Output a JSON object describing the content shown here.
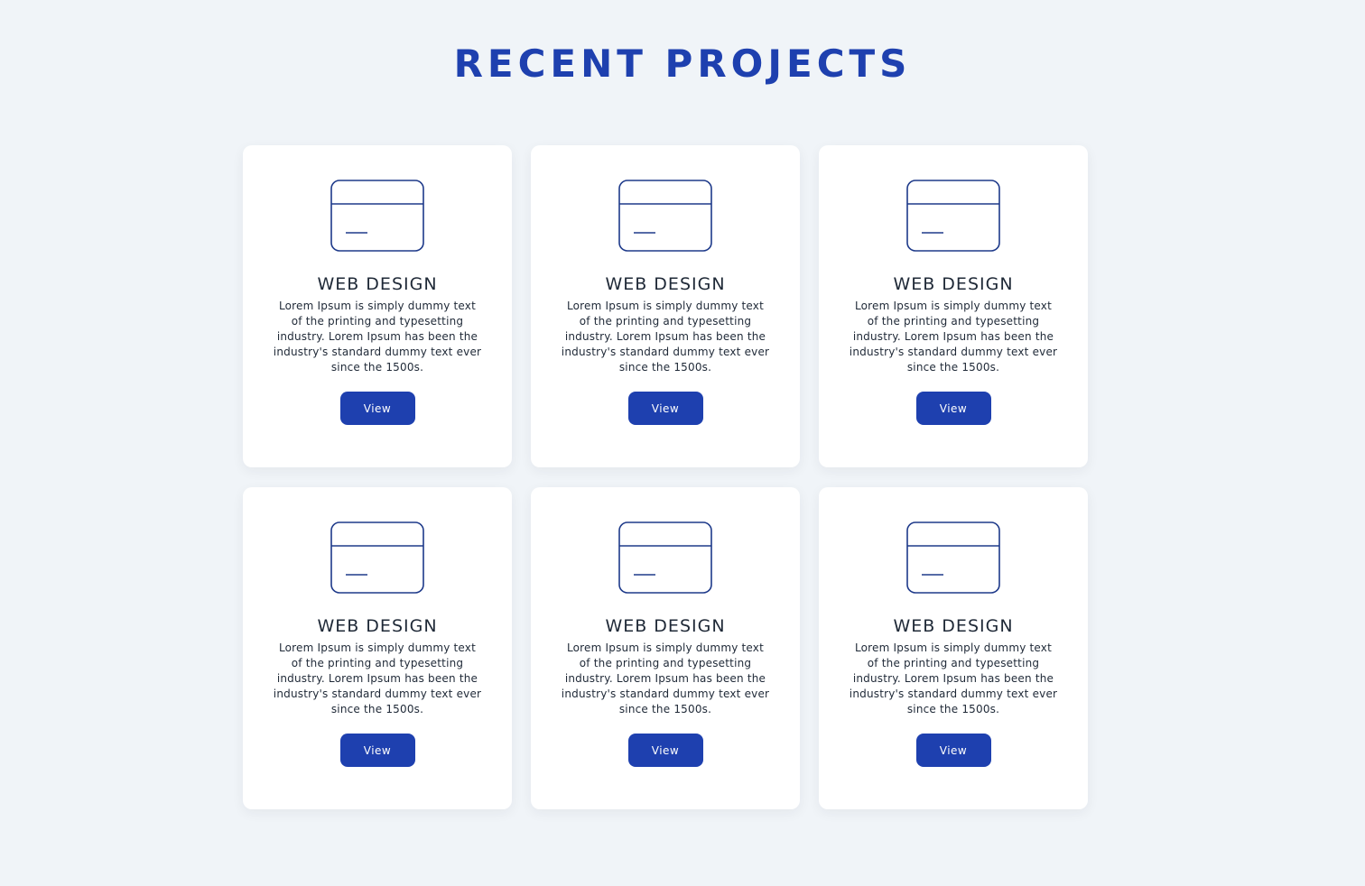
{
  "page": {
    "title": "RECENT PROJECTS"
  },
  "theme": {
    "background": "#f0f4f8",
    "accent": "#1e40af",
    "icon_stroke": "#1e3a8a",
    "card_background": "#ffffff",
    "text_color": "#1f2937"
  },
  "cards": [
    {
      "icon": "browser-window-icon",
      "title": "WEB DESIGN",
      "text": "Lorem Ipsum is simply dummy text of the printing and typesetting industry. Lorem Ipsum has been the industry's standard dummy text ever since the 1500s.",
      "button_label": "View"
    },
    {
      "icon": "browser-window-icon",
      "title": "WEB DESIGN",
      "text": "Lorem Ipsum is simply dummy text of the printing and typesetting industry. Lorem Ipsum has been the industry's standard dummy text ever since the 1500s.",
      "button_label": "View"
    },
    {
      "icon": "browser-window-icon",
      "title": "WEB DESIGN",
      "text": "Lorem Ipsum is simply dummy text of the printing and typesetting industry. Lorem Ipsum has been the industry's standard dummy text ever since the 1500s.",
      "button_label": "View"
    },
    {
      "icon": "browser-window-icon",
      "title": "WEB DESIGN",
      "text": "Lorem Ipsum is simply dummy text of the printing and typesetting industry. Lorem Ipsum has been the industry's standard dummy text ever since the 1500s.",
      "button_label": "View"
    },
    {
      "icon": "browser-window-icon",
      "title": "WEB DESIGN",
      "text": "Lorem Ipsum is simply dummy text of the printing and typesetting industry. Lorem Ipsum has been the industry's standard dummy text ever since the 1500s.",
      "button_label": "View"
    },
    {
      "icon": "browser-window-icon",
      "title": "WEB DESIGN",
      "text": "Lorem Ipsum is simply dummy text of the printing and typesetting industry. Lorem Ipsum has been the industry's standard dummy text ever since the 1500s.",
      "button_label": "View"
    }
  ]
}
